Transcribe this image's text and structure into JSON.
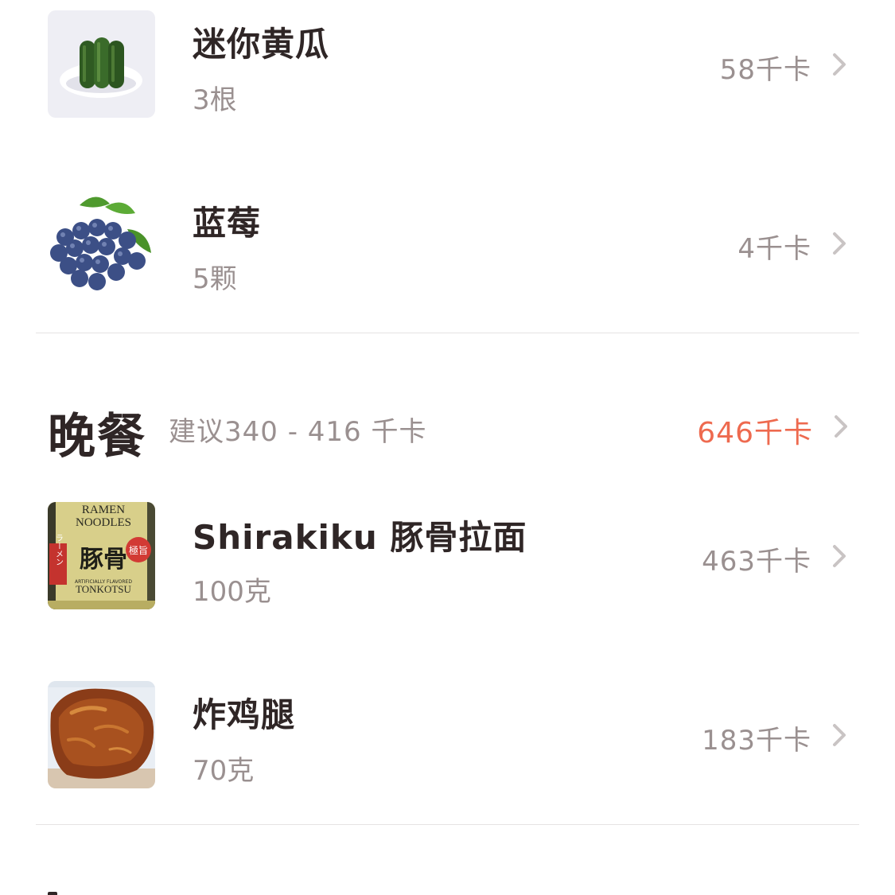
{
  "snack_section": {
    "items": [
      {
        "name": "迷你黄瓜",
        "quantity": "3根",
        "kcal": "58千卡",
        "image_icon": "cucumber-image"
      },
      {
        "name": "蓝莓",
        "quantity": "5颗",
        "kcal": "4千卡",
        "image_icon": "blueberry-image"
      }
    ]
  },
  "dinner": {
    "title": "晚餐",
    "suggestion": "建议340 - 416 千卡",
    "total": "646千卡",
    "total_color": "#ee6a4f",
    "items": [
      {
        "name": "Shirakiku 豚骨拉面",
        "quantity": "100克",
        "kcal": "463千卡",
        "image_icon": "ramen-package-image"
      },
      {
        "name": "炸鸡腿",
        "quantity": "70克",
        "kcal": "183千卡",
        "image_icon": "fried-chicken-image"
      }
    ]
  },
  "ramen_package": {
    "line1": "RAMEN",
    "line2": "NOODLES",
    "kanji": "豚骨",
    "side_label": "ラーメン",
    "badge": "極旨",
    "flavor_note": "ARTIFICIALLY FLAVORED",
    "flavor": "TONKOTSU"
  },
  "colors": {
    "text_primary": "#2f2626",
    "text_secondary": "#9a9090",
    "accent_over": "#ee6a4f",
    "divider": "#e6e3e3"
  }
}
